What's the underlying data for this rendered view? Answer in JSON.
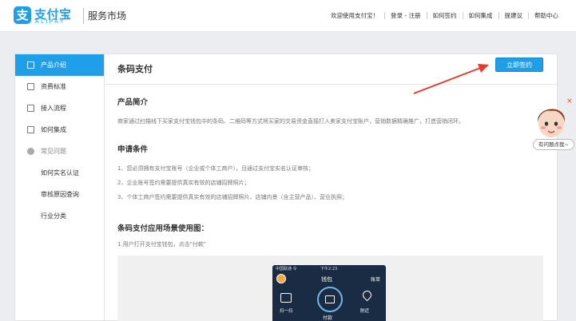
{
  "header": {
    "logo_mark": "支",
    "logo_cn": "支付宝",
    "logo_en": "ALIPAY",
    "site_name": "服务市场",
    "welcome": "欢迎使用支付宝！",
    "login": "登录 - 注册",
    "nav": [
      "如何签约",
      "如何集成",
      "提建议",
      "帮助中心"
    ]
  },
  "sidebar": {
    "items": [
      {
        "label": "产品介绍"
      },
      {
        "label": "资费标准"
      },
      {
        "label": "接入流程"
      },
      {
        "label": "如何集成"
      },
      {
        "label": "常见问题"
      }
    ],
    "sub_items": [
      "如何实名认证",
      "审核原因查询",
      "行业分类"
    ]
  },
  "main": {
    "title": "条码支付",
    "sign_button": "立即签约",
    "intro_title": "产品简介",
    "intro_text": "商家通过扫描线下买家支付宝钱包中的条码、二维码等方式将买家的交易资金直接打入卖家支付宝账户，营销数据精确推广，打造营销闭环。",
    "conditions_title": "申请条件",
    "conditions": [
      "1、您必须拥有支付宝账号（企业或个体工商户），且通过支付宝实名认证审核；",
      "2、企业账号签约需要提供真实有效的店铺招牌照片；",
      "3、个体工商户签约需要提供真实有效的店铺招牌照片、店铺内景（含主营产品）、营业执照；"
    ],
    "scenario_title": "条码支付应用场景使用图：",
    "scenario_step": "1.用户打开支付宝钱包，点击\"付款\""
  },
  "phone": {
    "status_left": "中国联通 令",
    "status_time": "下午2:23",
    "title": "钱包",
    "more": "账单",
    "scan_label": "扫一扫",
    "pay_label": "付款",
    "nearby_label": "附近"
  },
  "help": {
    "close": "×",
    "tip": "有问题点我~"
  },
  "colors": {
    "accent": "#1e9fe8",
    "arrow": "#e33b2e"
  }
}
